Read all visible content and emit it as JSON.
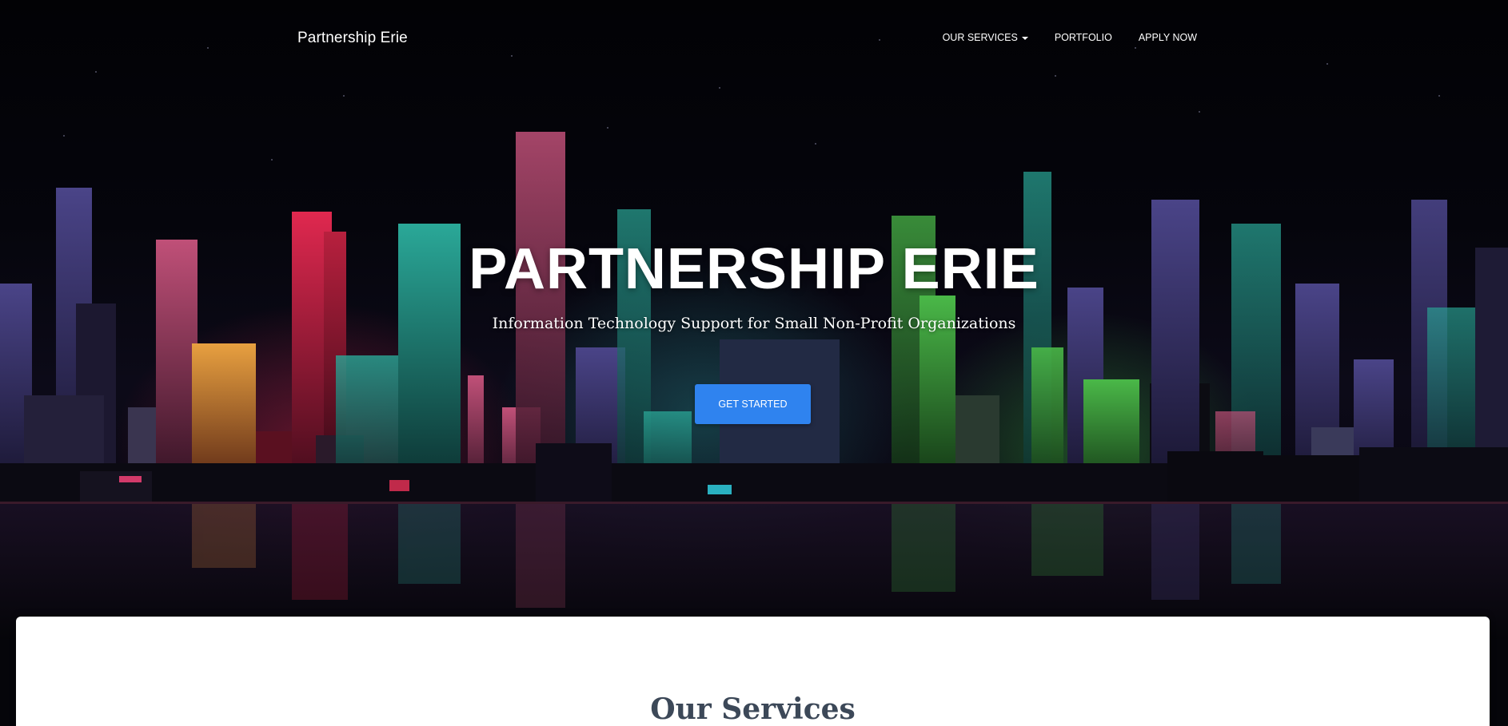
{
  "brand": "Partnership Erie",
  "nav": {
    "items": [
      {
        "label": "OUR SERVICES",
        "has_dropdown": true,
        "icon": "caret-down-icon"
      },
      {
        "label": "PORTFOLIO",
        "has_dropdown": false
      },
      {
        "label": "APPLY NOW",
        "has_dropdown": false
      }
    ]
  },
  "hero": {
    "title": "PARTNERSHIP ERIE",
    "subtitle": "Information Technology Support for Small Non-Profit Organizations",
    "cta_label": "GET STARTED",
    "background": "neon-city-skyline-image"
  },
  "services": {
    "title": "Our Services"
  },
  "colors": {
    "cta": "#2f83ef",
    "hero_bg": "#05050a",
    "section_title": "#3c4858",
    "neon_red": "#d2234a",
    "neon_teal": "#2fb8a8",
    "neon_green": "#4fc24a",
    "neon_purple": "#6a5ab0"
  }
}
